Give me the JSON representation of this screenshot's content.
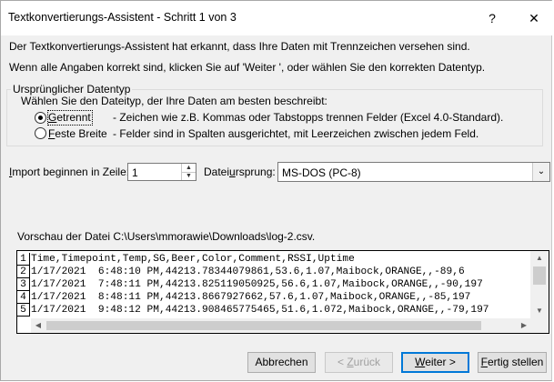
{
  "window": {
    "title": "Textkonvertierungs-Assistent - Schritt 1 von 3",
    "help_glyph": "?",
    "close_glyph": "✕"
  },
  "intro": {
    "line1": "Der Textkonvertierungs-Assistent hat erkannt, dass Ihre Daten mit Trennzeichen versehen sind.",
    "line2": "Wenn alle Angaben korrekt sind, klicken Sie auf 'Weiter ', oder wählen Sie den korrekten Datentyp."
  },
  "group": {
    "legend": "Ursprünglicher Datentyp",
    "prompt": "Wählen Sie den Dateityp, der Ihre Daten am besten beschreibt:",
    "options": [
      {
        "label_pre": "",
        "label_u": "G",
        "label_post": "etrennt",
        "desc": "- Zeichen wie z.B. Kommas oder Tabstopps trennen Felder (Excel 4.0-Standard).",
        "selected": true
      },
      {
        "label_pre": "",
        "label_u": "F",
        "label_post": "este Breite",
        "desc": "- Felder sind in Spalten ausgerichtet, mit Leerzeichen zwischen jedem Feld.",
        "selected": false
      }
    ]
  },
  "import_row": {
    "label_pre": "",
    "label_u": "I",
    "label_post": "mport beginnen in Zeile:",
    "value": "1",
    "origin_pre": "Datei",
    "origin_u": "u",
    "origin_post": "rsprung:",
    "origin_value": "MS-DOS (PC-8)"
  },
  "preview": {
    "label": "Vorschau der Datei C:\\Users\\mmorawie\\Downloads\\log-2.csv.",
    "row_numbers": [
      "1",
      "2",
      "3",
      "4",
      "5"
    ],
    "lines": [
      "Time,Timepoint,Temp,SG,Beer,Color,Comment,RSSI,Uptime",
      "1/17/2021  6:48:10 PM,44213.78344079861,53.6,1.07,Maibock,ORANGE,,-89,6",
      "1/17/2021  7:48:11 PM,44213.825119050925,56.6,1.07,Maibock,ORANGE,,-90,197",
      "1/17/2021  8:48:11 PM,44213.8667927662,57.6,1.07,Maibock,ORANGE,,-85,197",
      "1/17/2021  9:48:12 PM,44213.908465775465,51.6,1.072,Maibock,ORANGE,,-79,197"
    ]
  },
  "buttons": {
    "cancel": "Abbrechen",
    "back_pre": "< ",
    "back_u": "Z",
    "back_post": "urück",
    "next_pre": "",
    "next_u": "W",
    "next_post": "eiter >",
    "finish_pre": "",
    "finish_u": "F",
    "finish_post": "ertig stellen"
  }
}
